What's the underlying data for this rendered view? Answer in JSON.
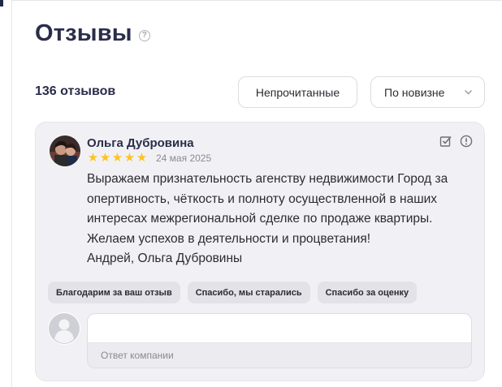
{
  "header": {
    "title": "Отзывы",
    "help_icon": "question-circle-icon"
  },
  "toolbar": {
    "count_label": "136 отзывов",
    "unread_button": "Непрочитанные",
    "sort": {
      "selected": "По новизне",
      "icon": "chevron-down-icon"
    }
  },
  "review": {
    "author": "Ольга Дубровина",
    "rating": 5,
    "rating_max": 5,
    "date": "24 мая 2025",
    "text_lines": [
      "Выражаем признательность агенству недвижимости Город за",
      "опертивность, чёткость и полноту осуществленной в наших",
      "интересах межрегиональной сделке по продаже квартиры.",
      "Желаем успехов в деятельности и процветания!",
      "Андрей, Ольга Дубровины"
    ],
    "actions": {
      "mark_read_icon": "check-square-icon",
      "report_icon": "exclamation-circle-icon"
    },
    "quick_replies": [
      "Благодарим за ваш отзыв",
      "Спасибо, мы старались",
      "Спасибо за оценку"
    ],
    "reply": {
      "value": "",
      "placeholder": "",
      "label": "Ответ компании"
    }
  },
  "colors": {
    "title": "#2a2d4a",
    "star": "#ffc31f",
    "card_bg": "#f1f1f5",
    "chip_bg": "#e2e2e8",
    "muted_text": "#8a8a94"
  }
}
